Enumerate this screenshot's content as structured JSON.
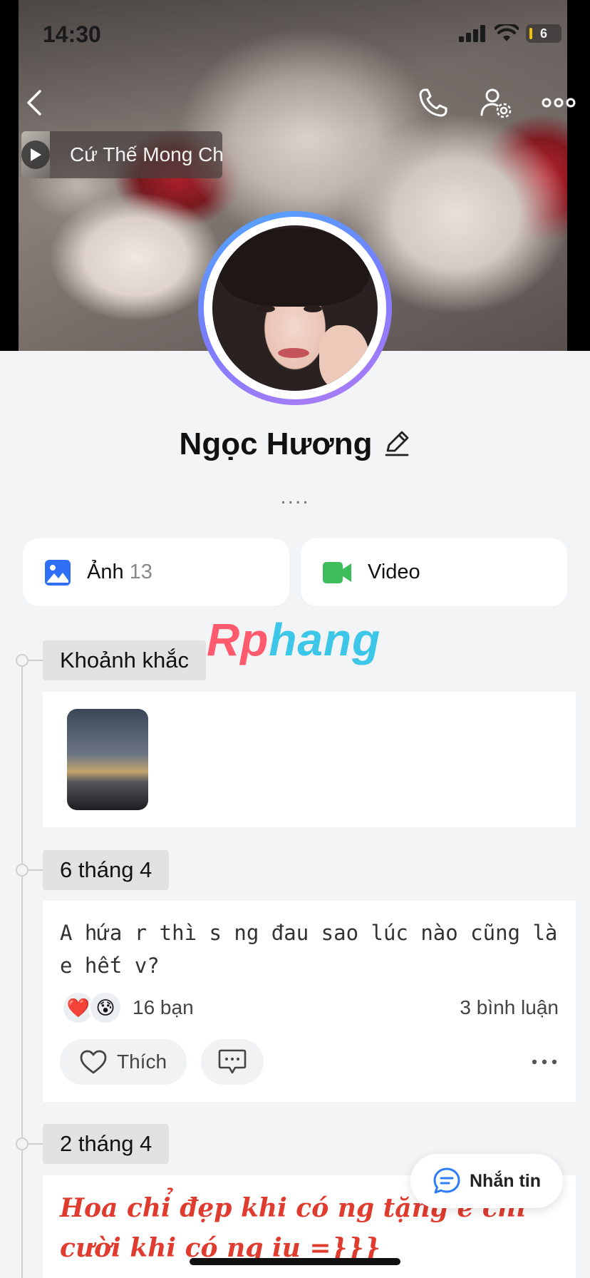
{
  "status": {
    "time": "14:30",
    "battery": "6"
  },
  "music": {
    "title": "Cứ Thế Mong Chờ"
  },
  "profile": {
    "name": "Ngọc Hương",
    "bio": "...."
  },
  "media": {
    "photo_label": "Ảnh",
    "photo_count": "13",
    "video_label": "Video"
  },
  "watermark": {
    "part1": "Rp",
    "part2": "hang"
  },
  "timeline": {
    "moments_label": "Khoảnh khắc",
    "posts": [
      {
        "date": "6 tháng 4",
        "text": "A hứa r thì s ng đau sao lúc nào cũng là e hết v?",
        "reaction_count": "16 bạn",
        "comment_count": "3 bình luận",
        "like_label": "Thích"
      },
      {
        "date": "2 tháng 4",
        "text": "Hoa chỉ đẹp khi có ng tặng e chỉ cười khi có ng iu =}}}"
      }
    ]
  },
  "fab": {
    "message_label": "Nhắn tin"
  },
  "colors": {
    "avatar_ring_start": "#4ea8ff",
    "avatar_ring_end": "#b27cf4",
    "photo_icon": "#2f6ff5",
    "video_icon": "#3dbd5a",
    "post_red": "#e03b2f",
    "message_icon": "#2f7df6"
  }
}
